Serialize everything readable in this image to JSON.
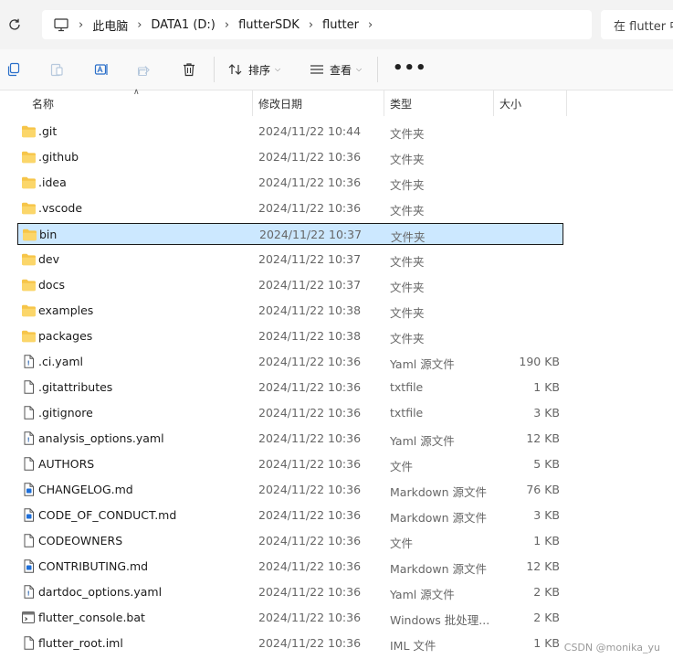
{
  "breadcrumb": {
    "items": [
      "此电脑",
      "DATA1 (D:)",
      "flutterSDK",
      "flutter"
    ]
  },
  "search": {
    "placeholder": "在 flutter 中搜索"
  },
  "toolbar": {
    "sort_label": "排序",
    "view_label": "查看",
    "icons": [
      "copy-icon",
      "paste-icon",
      "rename-icon",
      "share-icon",
      "delete-icon",
      "sort-icon",
      "view-icon",
      "more-icon"
    ]
  },
  "columns": {
    "name": "名称",
    "date": "修改日期",
    "type": "类型",
    "size": "大小"
  },
  "files": [
    {
      "name": ".git",
      "date": "2024/11/22 10:44",
      "type": "文件夹",
      "size": "",
      "icon": "folder-icon"
    },
    {
      "name": ".github",
      "date": "2024/11/22 10:36",
      "type": "文件夹",
      "size": "",
      "icon": "folder-icon"
    },
    {
      "name": ".idea",
      "date": "2024/11/22 10:36",
      "type": "文件夹",
      "size": "",
      "icon": "folder-icon"
    },
    {
      "name": ".vscode",
      "date": "2024/11/22 10:36",
      "type": "文件夹",
      "size": "",
      "icon": "folder-icon"
    },
    {
      "name": "bin",
      "date": "2024/11/22 10:37",
      "type": "文件夹",
      "size": "",
      "icon": "folder-icon",
      "selected": true
    },
    {
      "name": "dev",
      "date": "2024/11/22 10:37",
      "type": "文件夹",
      "size": "",
      "icon": "folder-icon"
    },
    {
      "name": "docs",
      "date": "2024/11/22 10:37",
      "type": "文件夹",
      "size": "",
      "icon": "folder-icon"
    },
    {
      "name": "examples",
      "date": "2024/11/22 10:38",
      "type": "文件夹",
      "size": "",
      "icon": "folder-icon"
    },
    {
      "name": "packages",
      "date": "2024/11/22 10:38",
      "type": "文件夹",
      "size": "",
      "icon": "folder-icon"
    },
    {
      "name": ".ci.yaml",
      "date": "2024/11/22 10:36",
      "type": "Yaml 源文件",
      "size": "190 KB",
      "icon": "yaml-file-icon"
    },
    {
      "name": ".gitattributes",
      "date": "2024/11/22 10:36",
      "type": "txtfile",
      "size": "1 KB",
      "icon": "file-icon"
    },
    {
      "name": ".gitignore",
      "date": "2024/11/22 10:36",
      "type": "txtfile",
      "size": "3 KB",
      "icon": "file-icon"
    },
    {
      "name": "analysis_options.yaml",
      "date": "2024/11/22 10:36",
      "type": "Yaml 源文件",
      "size": "12 KB",
      "icon": "yaml-file-icon"
    },
    {
      "name": "AUTHORS",
      "date": "2024/11/22 10:36",
      "type": "文件",
      "size": "5 KB",
      "icon": "file-icon"
    },
    {
      "name": "CHANGELOG.md",
      "date": "2024/11/22 10:36",
      "type": "Markdown 源文件",
      "size": "76 KB",
      "icon": "markdown-file-icon"
    },
    {
      "name": "CODE_OF_CONDUCT.md",
      "date": "2024/11/22 10:36",
      "type": "Markdown 源文件",
      "size": "3 KB",
      "icon": "markdown-file-icon"
    },
    {
      "name": "CODEOWNERS",
      "date": "2024/11/22 10:36",
      "type": "文件",
      "size": "1 KB",
      "icon": "file-icon"
    },
    {
      "name": "CONTRIBUTING.md",
      "date": "2024/11/22 10:36",
      "type": "Markdown 源文件",
      "size": "12 KB",
      "icon": "markdown-file-icon"
    },
    {
      "name": "dartdoc_options.yaml",
      "date": "2024/11/22 10:36",
      "type": "Yaml 源文件",
      "size": "2 KB",
      "icon": "yaml-file-icon"
    },
    {
      "name": "flutter_console.bat",
      "date": "2024/11/22 10:36",
      "type": "Windows 批处理...",
      "size": "2 KB",
      "icon": "batch-file-icon"
    },
    {
      "name": "flutter_root.iml",
      "date": "2024/11/22 10:36",
      "type": "IML 文件",
      "size": "1 KB",
      "icon": "file-icon"
    }
  ],
  "watermark": "CSDN @monika_yu",
  "colors": {
    "folder": "#f4c542",
    "selection_bg": "#cce8ff",
    "selection_border": "#1a1a1a"
  }
}
